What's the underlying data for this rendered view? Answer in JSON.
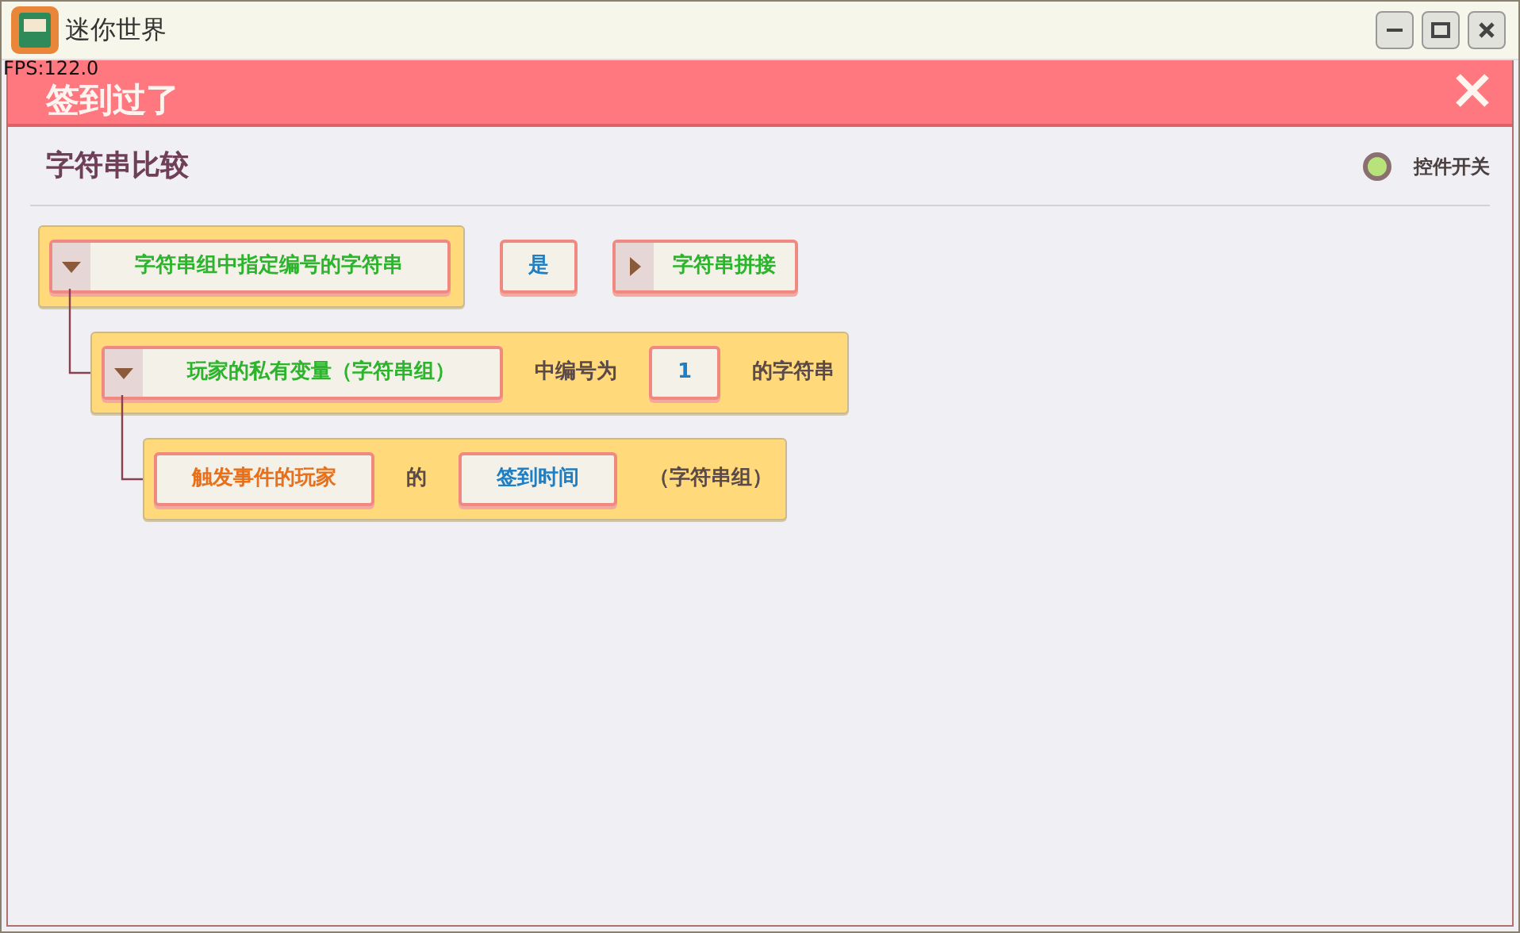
{
  "window": {
    "title": "迷你世界"
  },
  "fps": "FPS:122.0",
  "dialog": {
    "title": "签到过了"
  },
  "section": {
    "title": "字符串比较",
    "toggle": {
      "label": "控件开关",
      "on": true
    }
  },
  "block": {
    "parts": [
      {
        "kind": "dropdown",
        "text": "字符串组中指定编号的字符串",
        "color": "#2cb52c"
      }
    ],
    "trailing": [
      {
        "kind": "input",
        "text": "是",
        "color": "#1f7fc4"
      },
      {
        "kind": "expander",
        "text": "字符串拼接",
        "color": "#2cb52c"
      }
    ],
    "children": [
      {
        "parts": [
          {
            "kind": "dropdown",
            "text": "玩家的私有变量（字符串组）",
            "color": "#2cb52c"
          },
          {
            "kind": "text",
            "text": "中编号为"
          },
          {
            "kind": "input",
            "text": "1",
            "color": "#1f7fc4"
          },
          {
            "kind": "text",
            "text": "的字符串"
          }
        ],
        "children": [
          {
            "parts": [
              {
                "kind": "slot",
                "text": "触发事件的玩家",
                "color": "#e8701a"
              },
              {
                "kind": "text",
                "text": "的"
              },
              {
                "kind": "slot",
                "text": "签到时间",
                "color": "#1f7fc4"
              },
              {
                "kind": "text",
                "text": "（字符串组）"
              }
            ]
          }
        ]
      }
    ]
  }
}
